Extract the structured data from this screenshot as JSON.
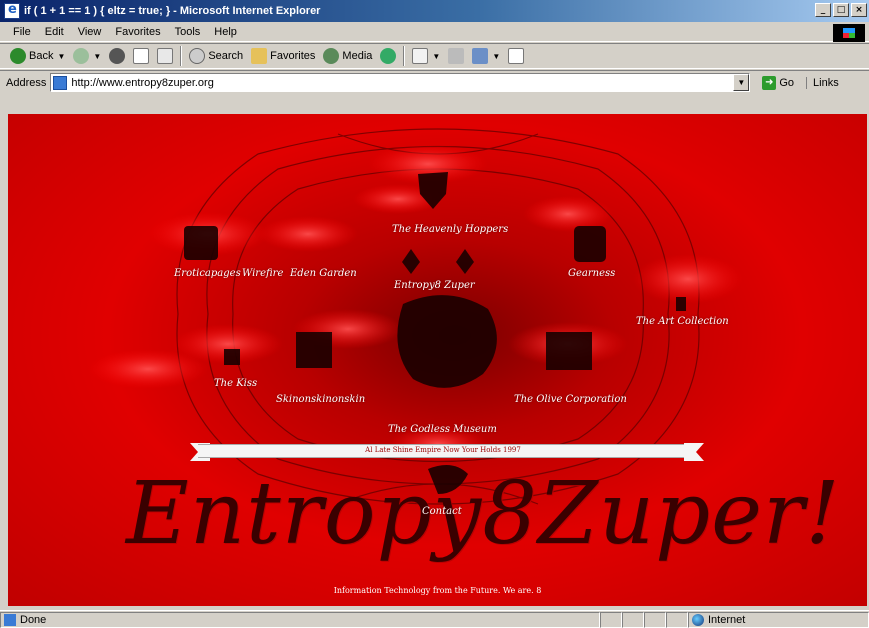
{
  "window": {
    "title": "if ( 1 + 1 == 1 ) { eltz = true; } - Microsoft Internet Explorer",
    "controls": [
      "_",
      "□",
      "×"
    ]
  },
  "menu": [
    "File",
    "Edit",
    "View",
    "Favorites",
    "Tools",
    "Help"
  ],
  "toolbar": {
    "back": "Back",
    "search": "Search",
    "favorites": "Favorites",
    "media": "Media"
  },
  "address": {
    "label": "Address",
    "url": "http://www.entropy8zuper.org",
    "go": "Go",
    "links": "Links"
  },
  "site": {
    "links": {
      "entropy8_zuper": "Entropy8 Zuper",
      "heavenly_hoppers": "The Heavenly Hoppers",
      "eroticapages": "Eroticapages",
      "wirefire": "Wirefire",
      "eden_garden": "Eden Garden",
      "gearness": "Gearness",
      "art_collection": "The Art Collection",
      "the_kiss": "The Kiss",
      "skinonskinonskin": "Skinonskinonskin",
      "olive_corporation": "The Olive Corporation",
      "godless_museum": "The Godless Museum",
      "contact": "Contact"
    },
    "ribbon_text": "Al Late Shine Empire Now Your Holds 1997",
    "big_title": "Entropy8Zuper!",
    "footer": "Information Technology from the Future. We are. 8"
  },
  "status": {
    "text": "Done",
    "zone": "Internet"
  }
}
